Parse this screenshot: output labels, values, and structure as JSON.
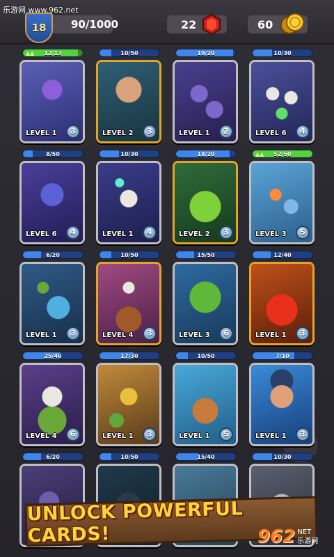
{
  "watermark": "乐游网 www.962.net",
  "header": {
    "player_level": "18",
    "xp": "90/1000",
    "gems": "22",
    "coins": "60"
  },
  "cards": [
    {
      "progress": "12/13",
      "fraction": 0.92,
      "level": "LEVEL 1",
      "count": "3",
      "border": "silver",
      "art": "spider-robot",
      "ready": true
    },
    {
      "progress": "10/50",
      "fraction": 0.2,
      "level": "LEVEL 2",
      "count": "3",
      "border": "gold",
      "art": "swordsman"
    },
    {
      "progress": "19/20",
      "fraction": 0.95,
      "level": "LEVEL 1",
      "count": "2",
      "border": "silver",
      "art": "bats"
    },
    {
      "progress": "10/30",
      "fraction": 0.33,
      "level": "LEVEL 6",
      "count": "4",
      "border": "silver",
      "art": "skeleton-army"
    },
    {
      "progress": "8/50",
      "fraction": 0.16,
      "level": "LEVEL 6",
      "count": "4",
      "border": "silver",
      "art": "gargoyle"
    },
    {
      "progress": "10/30",
      "fraction": 0.33,
      "level": "LEVEL 1",
      "count": "4",
      "border": "silver",
      "art": "skeleton-mage"
    },
    {
      "progress": "18/20",
      "fraction": 0.9,
      "level": "LEVEL 2",
      "count": "3",
      "border": "gold",
      "art": "poison-potion"
    },
    {
      "progress": "52/50",
      "fraction": 1.0,
      "level": "LEVEL 3",
      "count": "5",
      "border": "silver",
      "art": "jet-squad",
      "ready": true
    },
    {
      "progress": "6/20",
      "fraction": 0.3,
      "level": "LEVEL 1",
      "count": "3",
      "border": "silver",
      "art": "goblin-cannon"
    },
    {
      "progress": "10/50",
      "fraction": 0.2,
      "level": "LEVEL 4",
      "count": "3",
      "border": "gold",
      "art": "barrel-skeleton"
    },
    {
      "progress": "15/50",
      "fraction": 0.3,
      "level": "LEVEL 3",
      "count": "6",
      "border": "silver",
      "art": "orc"
    },
    {
      "progress": "12/40",
      "fraction": 0.3,
      "level": "LEVEL 1",
      "count": "3",
      "border": "gold",
      "art": "fire-potion"
    },
    {
      "progress": "25/40",
      "fraction": 0.62,
      "level": "LEVEL 4",
      "count": "6",
      "border": "silver",
      "art": "troll"
    },
    {
      "progress": "17/30",
      "fraction": 0.57,
      "level": "LEVEL 1",
      "count": "3",
      "border": "silver",
      "art": "goblin-knights"
    },
    {
      "progress": "10/50",
      "fraction": 0.2,
      "level": "LEVEL 1",
      "count": "5",
      "border": "silver",
      "art": "copter-bomb"
    },
    {
      "progress": "7/10",
      "fraction": 0.7,
      "level": "LEVEL 1",
      "count": "3",
      "border": "silver",
      "art": "ice-hero"
    },
    {
      "progress": "6/20",
      "fraction": 0.3,
      "level": "",
      "count": "",
      "border": "silver",
      "art": "crossbow-bat"
    },
    {
      "progress": "10/50",
      "fraction": 0.2,
      "level": "",
      "count": "",
      "border": "silver",
      "art": "shadow-beast"
    },
    {
      "progress": "15/40",
      "fraction": 0.37,
      "level": "",
      "count": "",
      "border": "silver",
      "art": "catapult"
    },
    {
      "progress": "10/30",
      "fraction": 0.33,
      "level": "",
      "count": "",
      "border": "silver",
      "art": "wolf"
    }
  ],
  "banner": "UNLOCK POWERFUL CARDS!",
  "logo": {
    "number": "962",
    "line1": "NET",
    "line2": "乐游网"
  },
  "colors": {
    "progress_blue": "#3f86e8",
    "progress_green": "#55d13c",
    "card_gold": "#e2a52a",
    "card_silver": "#bfbfc4",
    "banner_text": "#ffd23a"
  }
}
